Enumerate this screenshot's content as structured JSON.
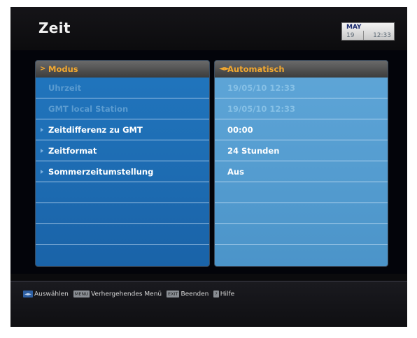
{
  "screen": {
    "title": "Zeit",
    "clock": {
      "month": "MAY",
      "day": "19",
      "time": "12:33"
    }
  },
  "left_panel": {
    "header": "Modus",
    "header_icon": "chevron-right-icon",
    "rows": [
      {
        "label": "Uhrzeit",
        "state": "disabled"
      },
      {
        "label": "GMT local Station",
        "state": "disabled"
      },
      {
        "label": "Zeitdifferenz zu GMT",
        "state": "active"
      },
      {
        "label": "Zeitformat",
        "state": "active"
      },
      {
        "label": "Sommerzeitumstellung",
        "state": "active"
      }
    ]
  },
  "right_panel": {
    "header": "Automatisch",
    "header_icon": "left-right-arrows-icon",
    "rows": [
      {
        "value": "19/05/10 12:33",
        "state": "disabled"
      },
      {
        "value": "19/05/10 12:33",
        "state": "disabled"
      },
      {
        "value": "00:00",
        "state": "active"
      },
      {
        "value": "24 Stunden",
        "state": "active"
      },
      {
        "value": "Aus",
        "state": "active"
      }
    ]
  },
  "footer": {
    "hints": [
      {
        "key": "◄►",
        "label": "Auswählen"
      },
      {
        "key": "MENU",
        "label": "Verhergehendes Menü"
      },
      {
        "key": "EXIT",
        "label": "Beenden"
      },
      {
        "key": "?",
        "label": "Hilfe"
      }
    ]
  },
  "colors": {
    "background": "#0b0b0d",
    "left_panel": "#1f70b8",
    "right_panel": "#55a0d4",
    "accent": "#f2a830"
  }
}
